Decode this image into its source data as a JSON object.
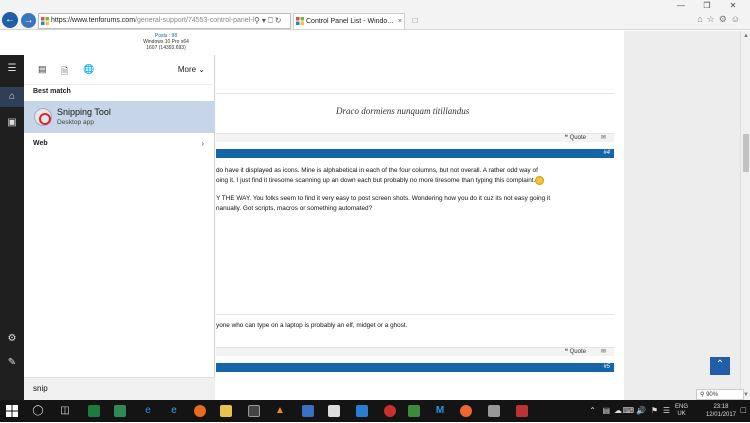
{
  "browser": {
    "url_host": "https://www.tenforums.com",
    "url_path": "/general-support/74553-control-panel-l",
    "tab_title": "Control Panel List - Windo...",
    "back_icon": "back-arrow-icon",
    "forward_icon": "forward-arrow-icon"
  },
  "forum": {
    "user_posts": "Posts : 98",
    "user_os": "Windows 10 Pro x64",
    "user_build": "1607 (14393.693)",
    "signature": "Draco dormiens nunquam titillandus",
    "quote_label": "Quote",
    "post4_number": "#4",
    "post4_line1": "do have it displayed as icons. Mine is alphabetical in each of the four columns, but not overall. A rather odd way of",
    "post4_line2": "oing it. I just find it tiresome scanning up an down each but probably no more tiresome than typing this complaint.",
    "post4_line3": "Y THE WAY. You folks seem to find it very easy to post screen shots. Wondering how you do it cuz its not easy going it",
    "post4_line4": "nanually. Got scripts, macros or something automated?",
    "post5_text": "yone who can type on a laptop is probably an elf, midget or a ghost.",
    "post5_number": "#5",
    "zoom": "90%"
  },
  "start": {
    "more_label": "More",
    "best_match_heading": "Best match",
    "result_title": "Snipping Tool",
    "result_subtitle": "Desktop app",
    "web_heading": "Web",
    "search_text": "snip"
  },
  "taskbar": {
    "lang_line1": "ENG",
    "lang_line2": "UK",
    "time": "23:18",
    "date": "12/01/2017"
  },
  "colors": {
    "accent": "#1565a9",
    "selection": "#c6d6e8",
    "taskbar": "#141414",
    "start_rail": "#1f1f1f"
  }
}
